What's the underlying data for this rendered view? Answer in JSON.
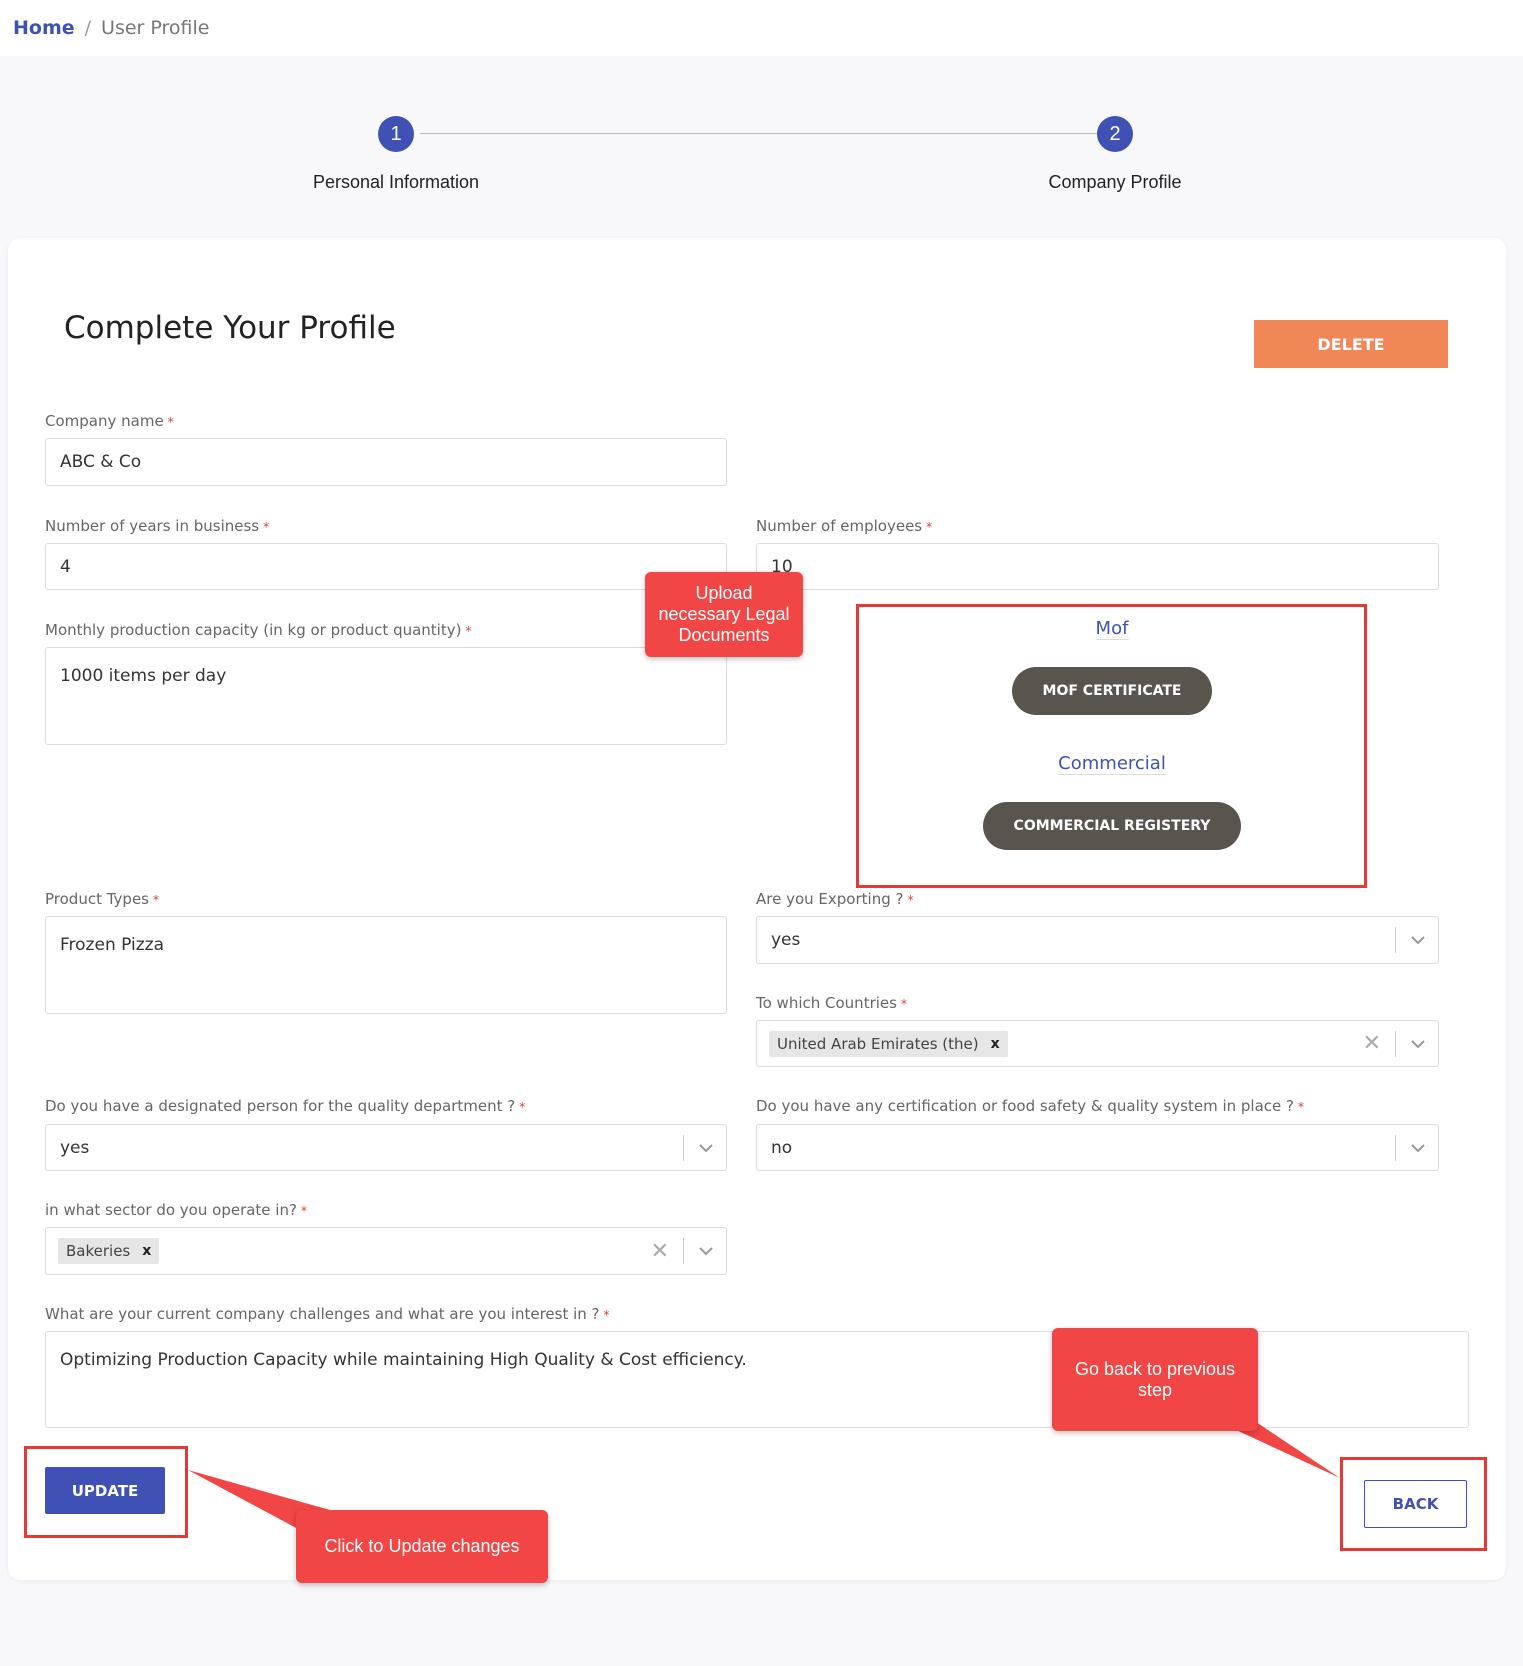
{
  "breadcrumb": {
    "home": "Home",
    "separator": "/",
    "current": "User Profile"
  },
  "stepper": {
    "steps": [
      {
        "number": "1",
        "label": "Personal Information"
      },
      {
        "number": "2",
        "label": "Company Profile"
      }
    ]
  },
  "page": {
    "title": "Complete Your Profile",
    "delete_label": "DELETE"
  },
  "form": {
    "required_mark": "*",
    "company_name": {
      "label": "Company name",
      "value": "ABC & Co"
    },
    "years_in_business": {
      "label": "Number of years in business",
      "value": "4"
    },
    "employees": {
      "label": "Number of employees",
      "value": "10"
    },
    "capacity": {
      "label": "Monthly production capacity (in kg or product quantity)",
      "value": "1000 items per day"
    },
    "product_types": {
      "label": "Product Types",
      "value": "Frozen Pizza"
    },
    "exporting": {
      "label": "Are you Exporting ?",
      "value": "yes"
    },
    "countries": {
      "label": "To which Countries",
      "chips": [
        "United Arab Emirates (the)"
      ],
      "chip_remove": "x"
    },
    "quality_person": {
      "label": "Do you have a designated person for the quality department ?",
      "value": "yes"
    },
    "certification": {
      "label": "Do you have any certification or food safety & quality system in place ?",
      "value": "no"
    },
    "sector": {
      "label": "in what sector do you operate in?",
      "chips": [
        "Bakeries"
      ],
      "chip_remove": "x"
    },
    "challenges": {
      "label": "What are your current company challenges and what are you interest in ?",
      "value": "Optimizing Production Capacity while maintaining High Quality & Cost efficiency."
    }
  },
  "documents": {
    "mof": {
      "link": "Mof",
      "button": "MOF CERTIFICATE"
    },
    "commercial": {
      "link": "Commercial",
      "button": "COMMERCIAL REGISTERY"
    }
  },
  "actions": {
    "update": "UPDATE",
    "back": "BACK"
  },
  "annotations": {
    "upload": "Upload necessary Legal Documents",
    "go_back": "Go back to previous step",
    "update": "Click to Update changes"
  },
  "icons": {
    "clear": "clear-icon",
    "chevron": "chevron-down-icon"
  },
  "colors": {
    "primary": "#3f51b5",
    "delete": "#f18656",
    "doc_button": "#5a544f",
    "annotation": "#f24545"
  }
}
